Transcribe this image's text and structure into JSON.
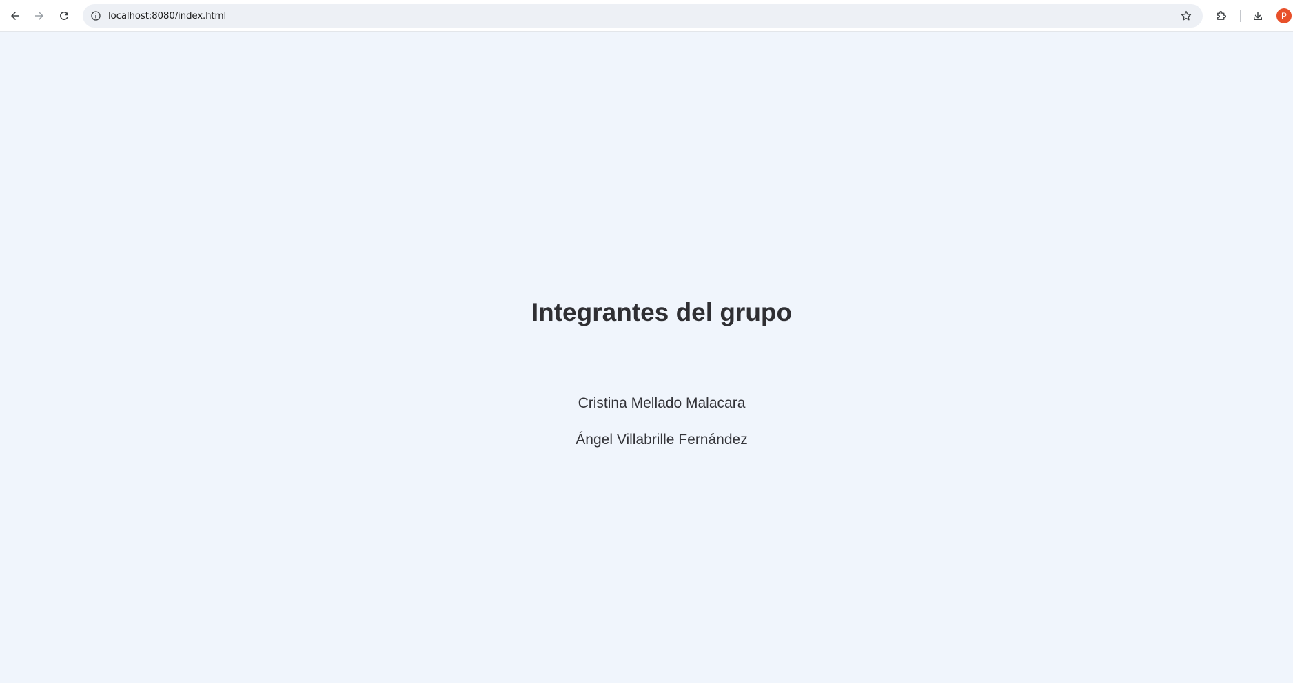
{
  "browser": {
    "url": "localhost:8080/index.html",
    "profile_initial": "P",
    "icons": {
      "back": "arrow-left-icon",
      "forward": "arrow-right-icon",
      "reload": "reload-icon",
      "site_info": "info-icon",
      "bookmark": "star-icon",
      "extensions": "puzzle-icon",
      "downloads": "download-icon"
    }
  },
  "page": {
    "title": "Integrantes del grupo",
    "members": [
      "Cristina Mellado Malacara",
      "Ángel Villabrille Fernández"
    ]
  },
  "colors": {
    "background": "#f0f5fc",
    "text": "#2f2f33",
    "avatar": "#e8502a"
  }
}
